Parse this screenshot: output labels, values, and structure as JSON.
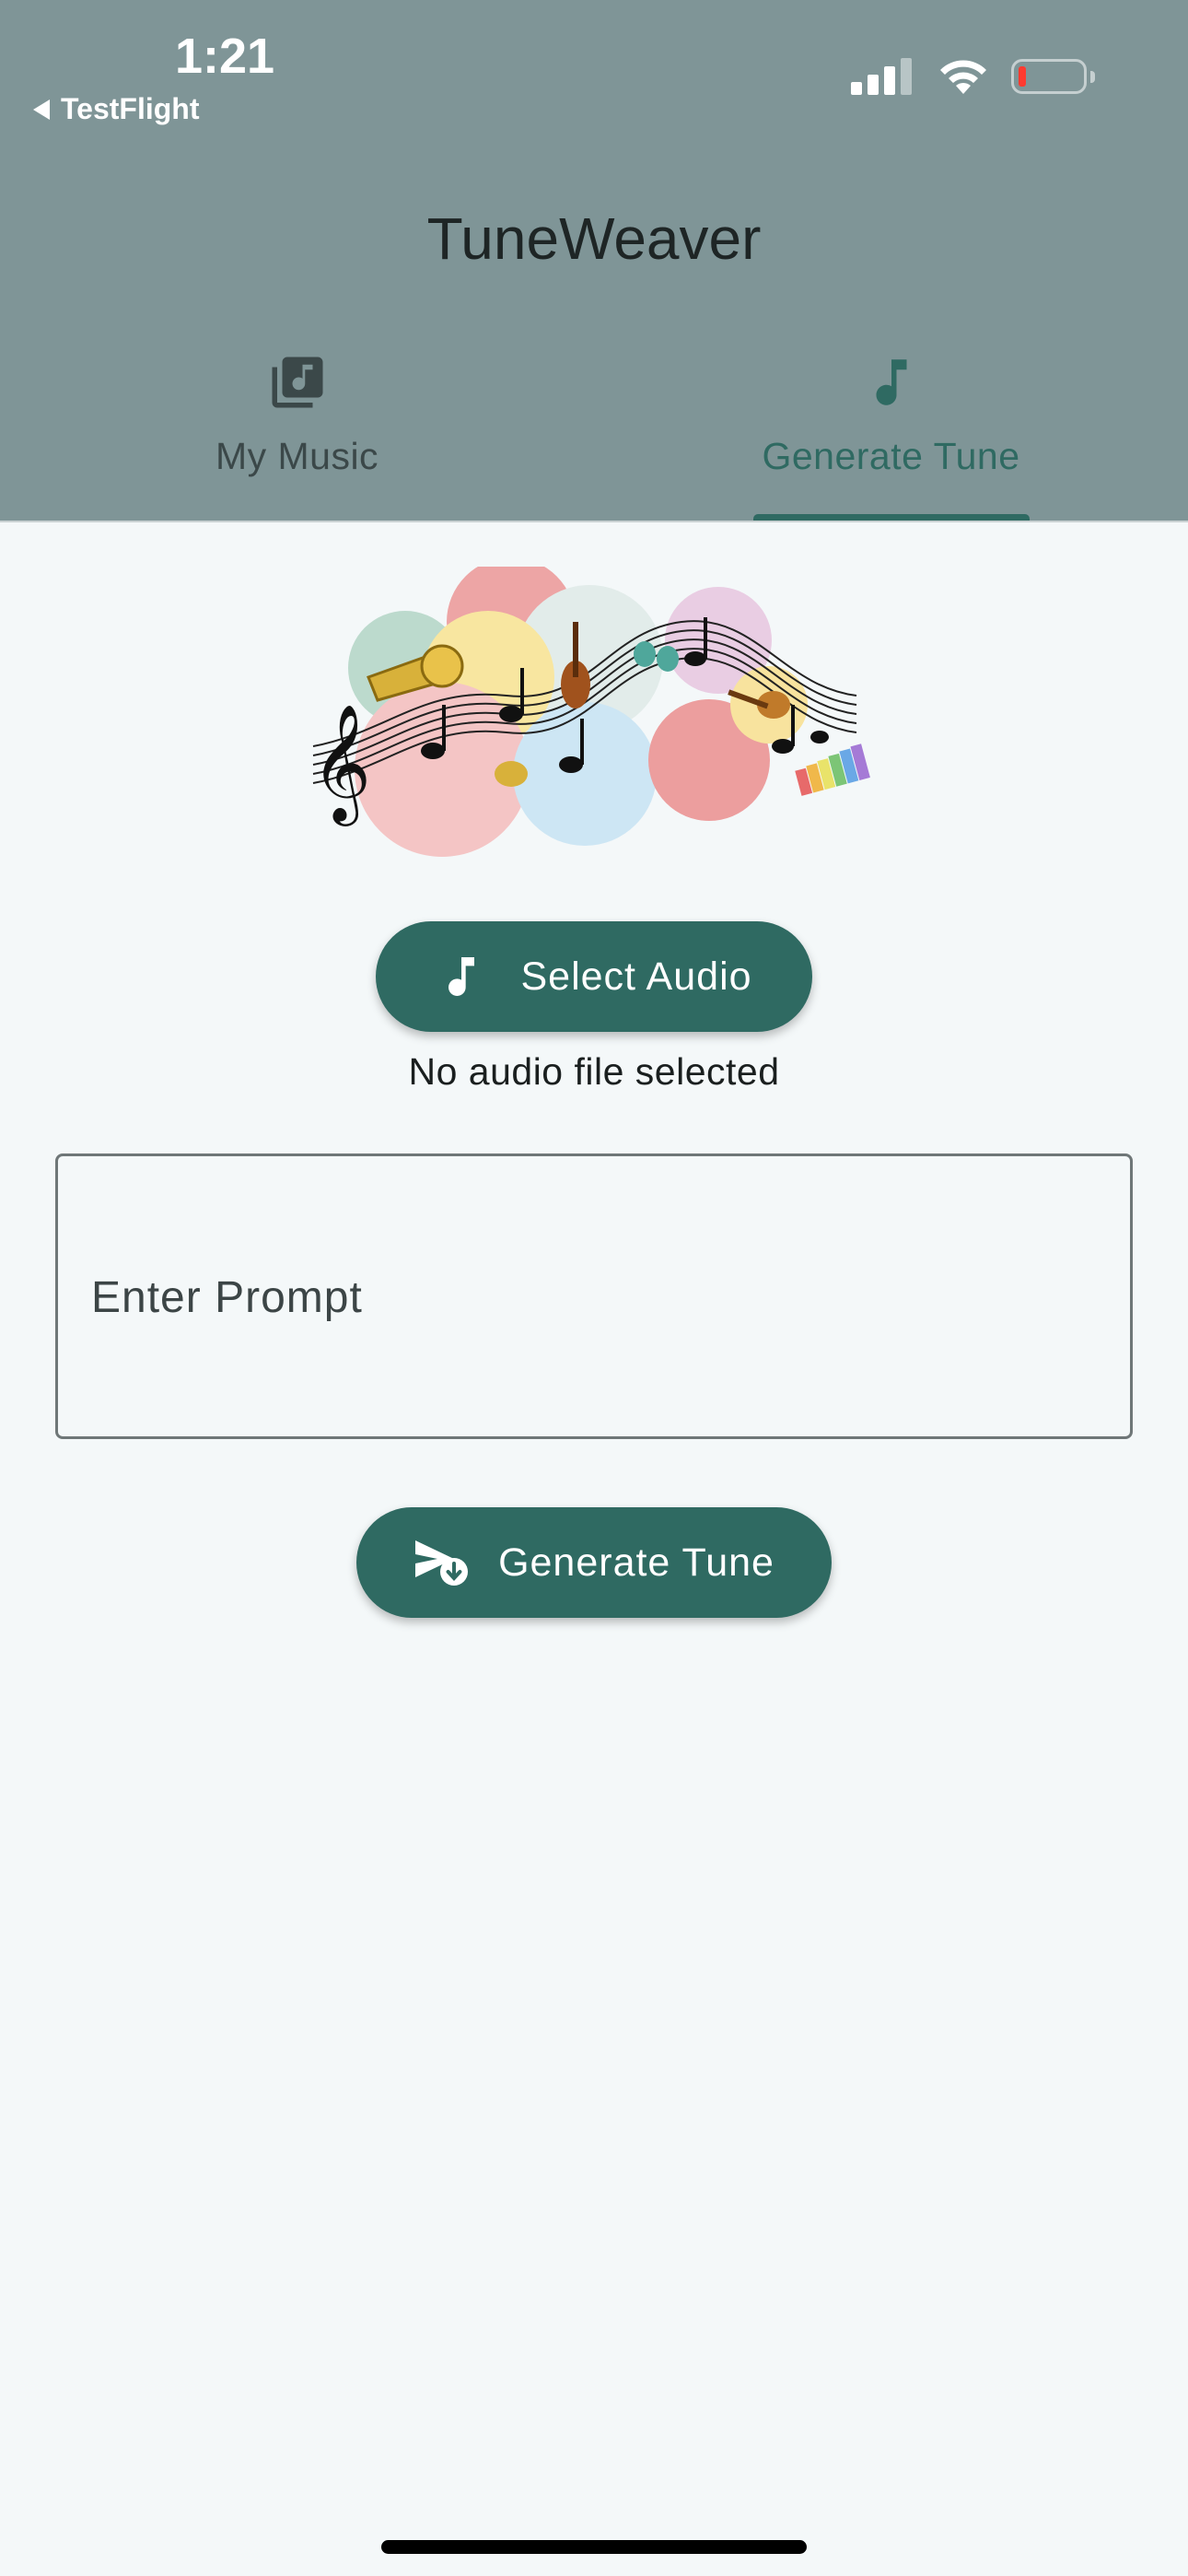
{
  "status_bar": {
    "time": "1:21",
    "back_app": "TestFlight",
    "battery_color": "#ff3b30"
  },
  "app_bar": {
    "title": "TuneWeaver"
  },
  "tabs": [
    {
      "label": "My Music",
      "icon": "library-music-icon",
      "selected": false
    },
    {
      "label": "Generate Tune",
      "icon": "music-note-icon",
      "selected": true
    }
  ],
  "main": {
    "banner_image": "music-instruments-illustration",
    "select_audio_label": "Select Audio",
    "file_status": "No audio file selected",
    "prompt_placeholder": "Enter Prompt",
    "prompt_value": "",
    "generate_label": "Generate Tune"
  },
  "colors": {
    "app_bar": "#7f9597",
    "accent": "#2f6a62",
    "background": "#f4f8f9"
  }
}
